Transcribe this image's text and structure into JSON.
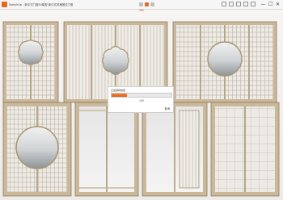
{
  "window": {
    "title": "SketchUp - 新中式门窗SU模型 新中式风格推拉门窗",
    "minimize": "—",
    "maximize": "☐",
    "close": "✕"
  },
  "toolbar": {
    "center_icons": [
      "select-tool-icon",
      "paint-tool-icon",
      "orbit-tool-icon",
      "pan-tool-icon",
      "zoom-tool-icon"
    ],
    "right_icons": [
      "file-icon",
      "save-icon",
      "undo-icon",
      "redo-icon",
      "print-icon"
    ],
    "accent_color": "#e06b2a"
  },
  "dialog": {
    "title": "正在保存模型",
    "message": "100",
    "cancel_label": "取消",
    "progress": 0.25,
    "progress_color": "#e86a1c"
  }
}
